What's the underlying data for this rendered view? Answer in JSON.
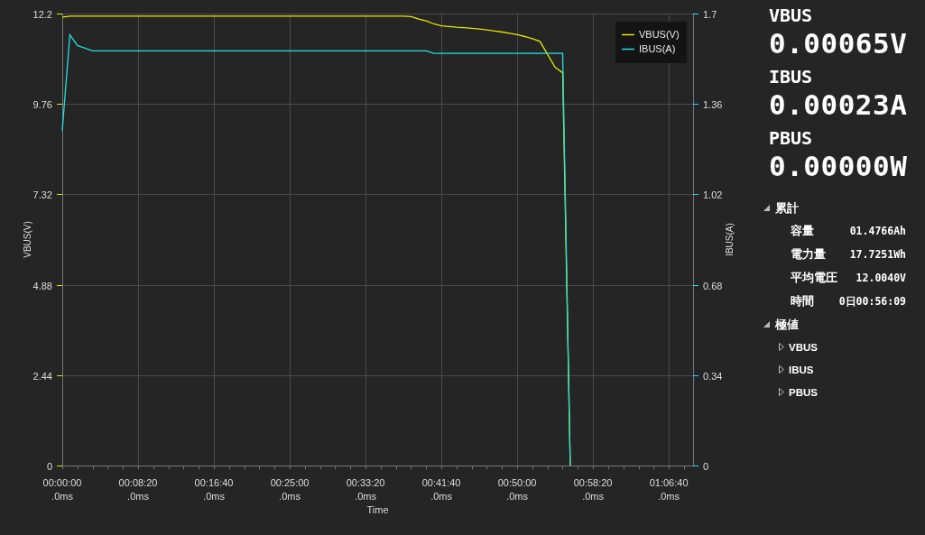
{
  "chart": {
    "chart_data": {
      "type": "line",
      "grid": true,
      "legend": "top-right",
      "xlabel": "Time",
      "ylabel": "VBUS(V)",
      "y2label": "IBUS(A)",
      "categories": [
        "00:00:00 .0ms",
        null,
        null,
        null,
        null,
        null,
        null,
        null,
        null,
        null,
        "00:08:20 .0ms",
        null,
        null,
        null,
        null,
        null,
        null,
        null,
        null,
        null,
        "00:16:40 .0ms",
        null,
        null,
        null,
        null,
        null,
        null,
        null,
        null,
        null,
        "00:25:00 .0ms",
        null,
        null,
        null,
        null,
        null,
        null,
        null,
        null,
        null,
        "00:33:20 .0ms",
        null,
        null,
        null,
        null,
        null,
        null,
        null,
        null,
        null,
        "00:41:40 .0ms",
        null,
        null,
        null,
        null,
        null,
        null,
        null,
        null,
        null,
        "00:50:00 .0ms",
        null,
        null,
        null,
        null,
        null,
        null,
        null,
        null,
        null,
        "00:58:20 .0ms",
        null,
        null,
        null,
        null,
        null,
        null,
        null,
        null,
        null,
        "01:06:40 .0ms",
        null,
        null,
        null
      ],
      "ylim": [
        0,
        12.2
      ],
      "y2lim": [
        0,
        1.7
      ],
      "yticks": [
        {
          "value": 0,
          "label": "0"
        },
        {
          "value": 2.44,
          "label": "2.44"
        },
        {
          "value": 4.88,
          "label": "4.88"
        },
        {
          "value": 7.32,
          "label": "7.32"
        },
        {
          "value": 9.76,
          "label": "9.76"
        },
        {
          "value": 12.2,
          "label": "12.2"
        }
      ],
      "y2ticks": [
        {
          "value": 0,
          "label": "0"
        },
        {
          "value": 0.34,
          "label": "0.34"
        },
        {
          "value": 0.68,
          "label": "0.68"
        },
        {
          "value": 1.02,
          "label": "1.02"
        },
        {
          "value": 1.36,
          "label": "1.36"
        },
        {
          "value": 1.7,
          "label": "1.7"
        }
      ],
      "series": [
        {
          "name": "VBUS(V)",
          "color": "#e6e600",
          "values": [
            12.1,
            12.13,
            12.13,
            12.13,
            12.13,
            12.13,
            12.13,
            12.13,
            12.13,
            12.13,
            12.13,
            12.13,
            12.13,
            12.13,
            12.13,
            12.13,
            12.13,
            12.13,
            12.13,
            12.13,
            12.13,
            12.13,
            12.13,
            12.13,
            12.13,
            12.13,
            12.13,
            12.13,
            12.13,
            12.13,
            12.13,
            12.13,
            12.13,
            12.13,
            12.13,
            12.13,
            12.13,
            12.13,
            12.13,
            12.13,
            12.13,
            12.13,
            12.13,
            12.13,
            12.13,
            12.13,
            12.12,
            12.05,
            12.0,
            11.92,
            11.87,
            11.85,
            11.83,
            11.82,
            11.8,
            11.78,
            11.76,
            11.73,
            11.7,
            11.67,
            11.63,
            11.58,
            11.52,
            11.45,
            11.1,
            10.75,
            10.6,
            0,
            null,
            null,
            null,
            null,
            null,
            null,
            null,
            null,
            null,
            null,
            null,
            null,
            null,
            null,
            null,
            null
          ]
        },
        {
          "name": "IBUS(A)",
          "color": "#22e0e0",
          "axis": "y2",
          "values": [
            1.26,
            1.62,
            1.58,
            1.57,
            1.56,
            1.56,
            1.56,
            1.56,
            1.56,
            1.56,
            1.56,
            1.56,
            1.56,
            1.56,
            1.56,
            1.56,
            1.56,
            1.56,
            1.56,
            1.56,
            1.56,
            1.56,
            1.56,
            1.56,
            1.56,
            1.56,
            1.56,
            1.56,
            1.56,
            1.56,
            1.56,
            1.56,
            1.56,
            1.56,
            1.56,
            1.56,
            1.56,
            1.56,
            1.56,
            1.56,
            1.56,
            1.56,
            1.56,
            1.56,
            1.56,
            1.56,
            1.56,
            1.56,
            1.56,
            1.55,
            1.55,
            1.55,
            1.55,
            1.55,
            1.55,
            1.55,
            1.55,
            1.55,
            1.55,
            1.55,
            1.55,
            1.55,
            1.55,
            1.55,
            1.55,
            1.55,
            1.55,
            0,
            null,
            null,
            null,
            null,
            null,
            null,
            null,
            null,
            null,
            null,
            null,
            null,
            null,
            null,
            null,
            null
          ]
        }
      ]
    }
  },
  "readings": [
    {
      "label": "VBUS",
      "value": "0.00065V"
    },
    {
      "label": "IBUS",
      "value": "0.00023A"
    },
    {
      "label": "PBUS",
      "value": "0.00000W"
    }
  ],
  "tree": [
    {
      "label": "累計",
      "expanded": true,
      "children": [
        {
          "label": "容量",
          "value": "01.4766Ah"
        },
        {
          "label": "電力量",
          "value": "17.7251Wh"
        },
        {
          "label": "平均電圧",
          "value": "12.0040V"
        },
        {
          "label": "時間",
          "value": "0日00:56:09"
        }
      ]
    },
    {
      "label": "極値",
      "expanded": true,
      "children": [
        {
          "label": "VBUS",
          "expanded": false
        },
        {
          "label": "IBUS",
          "expanded": false
        },
        {
          "label": "PBUS",
          "expanded": false
        }
      ]
    }
  ]
}
